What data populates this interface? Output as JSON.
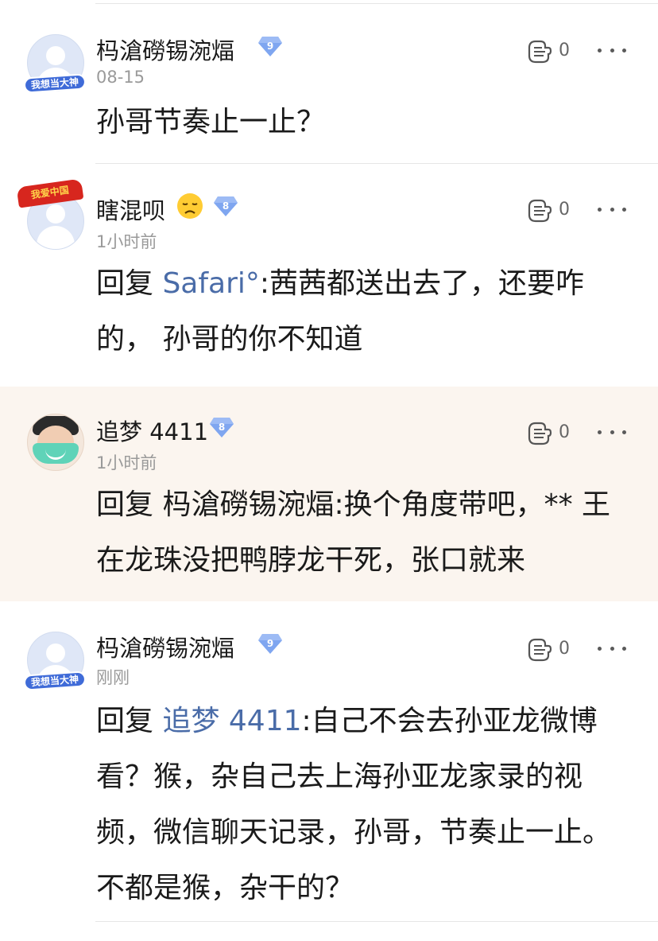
{
  "comments": [
    {
      "username": "杩滄磱锡涴煏",
      "level": "9",
      "timestamp": "08-15",
      "avatar_frame_text": "我想当大神",
      "likes": "0",
      "text": "孙哥节奏止一止？"
    },
    {
      "username": "瞎混呗",
      "emoji": "disappointed-face",
      "level": "8",
      "timestamp": "1小时前",
      "avatar_frame_text": "我爱中国",
      "likes": "0",
      "reply_prefix": "回复 ",
      "mention": "Safari°",
      "text": ":茜茜都送出去了，还要咋的， 孙哥的你不知道"
    },
    {
      "username": "追梦 4411",
      "level": "8",
      "timestamp": "1小时前",
      "likes": "0",
      "reply_prefix": "回复 杩滄磱锡涴煏",
      "text": ":换个角度带吧，** 王在龙珠没把鸭脖龙干死，张口就来"
    },
    {
      "username": "杩滄磱锡涴煏",
      "level": "9",
      "timestamp": "刚刚",
      "avatar_frame_text": "我想当大神",
      "likes": "0",
      "reply_prefix": "回复 ",
      "mention": "追梦 4411",
      "text": ":自己不会去孙亚龙微博看？猴，杂自己去上海孙亚龙家录的视频，微信聊天记录，孙哥，节奏止一止。不都是猴，杂干的？"
    }
  ],
  "colors": {
    "mention": "#4a6ca8",
    "highlight_bg": "#fbf5ef",
    "level_badge": "#7fa6f0"
  }
}
